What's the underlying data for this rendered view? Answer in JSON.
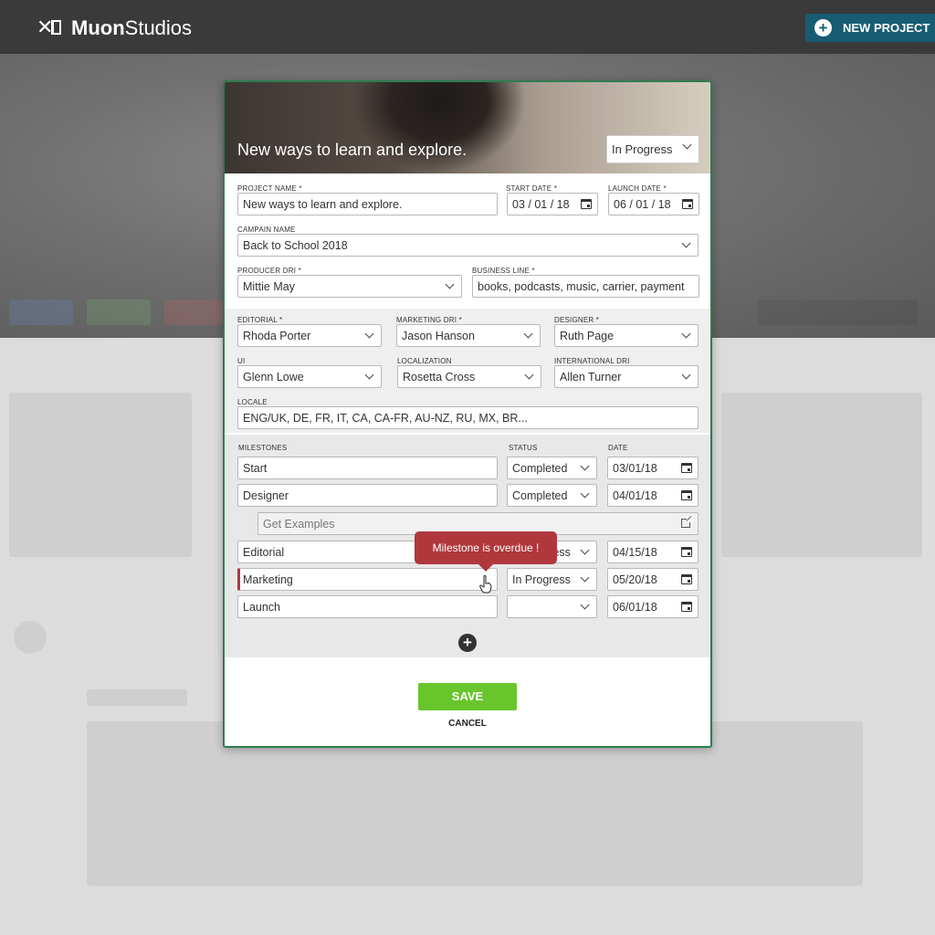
{
  "app": {
    "brand_bold": "Muon",
    "brand_light": "Studios",
    "new_project_label": "NEW PROJECT"
  },
  "modal": {
    "hero_title": "New ways to learn and explore.",
    "status": "In Progress",
    "project_name": {
      "label": "PROJECT NAME  *",
      "value": "New ways to learn and explore."
    },
    "start_date": {
      "label": "START DATE  *",
      "value": "03 / 01 / 18"
    },
    "launch_date": {
      "label": "LAUNCH DATE  *",
      "value": "06 / 01 / 18"
    },
    "campaign_name": {
      "label": "CAMPAIN NAME",
      "value": "Back to School 2018"
    },
    "producer_dri": {
      "label": "PRODUCER DRI *",
      "value": "Mittie May"
    },
    "business_line": {
      "label": "BUSINESS LINE *",
      "value": "books, podcasts, music, carrier, payment"
    },
    "editorial": {
      "label": "EDITORIAL *",
      "value": "Rhoda Porter"
    },
    "marketing_dri": {
      "label": "MARKETING DRI *",
      "value": "Jason Hanson"
    },
    "designer": {
      "label": "DESIGNER *",
      "value": "Ruth Page"
    },
    "ui": {
      "label": "UI",
      "value": "Glenn Lowe"
    },
    "localization": {
      "label": "LOCALIZATION",
      "value": "Rosetta Cross"
    },
    "international_dri": {
      "label": "INTERNATIONAL DRI",
      "value": "Allen Turner"
    },
    "locale": {
      "label": "LOCALE",
      "value": "ENG/UK, DE, FR, IT, CA, CA-FR, AU-NZ, RU, MX, BR..."
    },
    "milestones_header": {
      "milestones": "MILESTONES",
      "status": "STATUS",
      "date": "DATE"
    },
    "milestones": [
      {
        "name": "Start",
        "status": "Completed",
        "date": "03/01/18"
      },
      {
        "name": "Designer",
        "status": "Completed",
        "date": "04/01/18"
      },
      {
        "name": "Editorial",
        "status": "In Progress",
        "date": "04/15/18"
      },
      {
        "name": "Marketing",
        "status": "In Progress",
        "date": "05/20/18"
      },
      {
        "name": "Launch",
        "status": "",
        "date": "06/01/18"
      }
    ],
    "get_examples_placeholder": "Get Examples",
    "tooltip": "Milestone is overdue !",
    "save_label": "SAVE",
    "cancel_label": "CANCEL"
  }
}
